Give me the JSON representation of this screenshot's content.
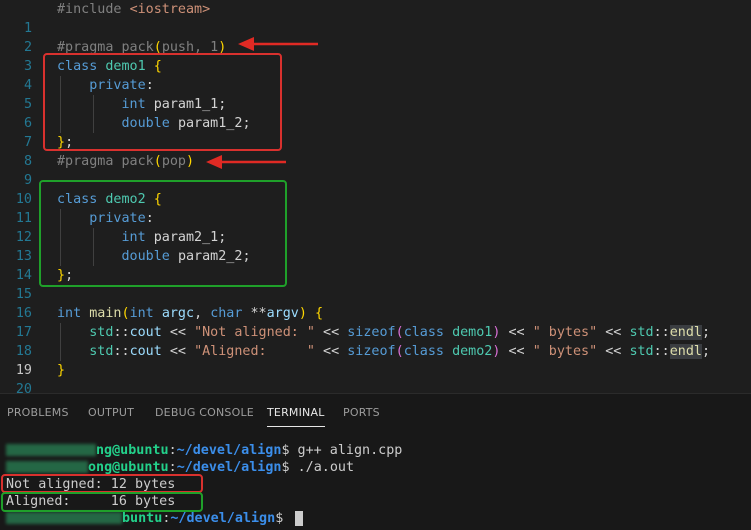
{
  "editor": {
    "line_numbers": [
      "1",
      "2",
      "3",
      "4",
      "5",
      "6",
      "7",
      "8",
      "9",
      "10",
      "11",
      "12",
      "13",
      "14",
      "15",
      "16",
      "17",
      "18",
      "19",
      "20"
    ],
    "code": {
      "l1": {
        "pre": "#include",
        "hdr": "<iostream>"
      },
      "l3": {
        "pre": "#pragma",
        "rest": " pack",
        "p1": "(",
        "args": "push, 1",
        "p2": ")"
      },
      "l4": {
        "kw": "class",
        "name": "demo1",
        "brace": "{"
      },
      "l5": {
        "access": "private",
        "colon": ":"
      },
      "l6": {
        "type": "int",
        "name": "param1_1",
        "semi": ";"
      },
      "l7": {
        "type": "double",
        "name": "param1_2",
        "semi": ";"
      },
      "l8": {
        "brace": "}",
        "semi": ";"
      },
      "l9": {
        "pre": "#pragma",
        "rest": " pack",
        "p1": "(",
        "args": "pop",
        "p2": ")"
      },
      "l11": {
        "kw": "class",
        "name": "demo2",
        "brace": "{"
      },
      "l12": {
        "access": "private",
        "colon": ":"
      },
      "l13": {
        "type": "int",
        "name": "param2_1",
        "semi": ";"
      },
      "l14": {
        "type": "double",
        "name": "param2_2",
        "semi": ";"
      },
      "l15": {
        "brace": "}",
        "semi": ";"
      },
      "l17": {
        "ret": "int",
        "fn": "main",
        "p1": "(",
        "t1": "int",
        "a1": "argc",
        "comma": ",",
        "t2": "char",
        "stars": "**",
        "a2": "argv",
        "p2": ")",
        "brace": "{"
      },
      "l18": {
        "ns": "std",
        "sep": "::",
        "cout": "cout",
        "op": " << ",
        "str": "\"Not aligned: \"",
        "op2": " << ",
        "fn": "sizeof",
        "p1": "(",
        "kw": "class",
        "cls": "demo1",
        "p2": ")",
        "op3": " << ",
        "str2": "\" bytes\"",
        "op4": " << ",
        "ns2": "std",
        "sep2": "::",
        "endl": "endl",
        "semi": ";"
      },
      "l19": {
        "ns": "std",
        "sep": "::",
        "cout": "cout",
        "op": " << ",
        "str": "\"Aligned:     \"",
        "op2": " << ",
        "fn": "sizeof",
        "p1": "(",
        "kw": "class",
        "cls": "demo2",
        "p2": ")",
        "op3": " << ",
        "str2": "\" bytes\"",
        "op4": " << ",
        "ns2": "std",
        "sep2": "::",
        "endl": "endl",
        "semi": ";"
      },
      "l20": {
        "brace": "}"
      }
    }
  },
  "panel": {
    "tabs": [
      "PROBLEMS",
      "OUTPUT",
      "DEBUG CONSOLE",
      "TERMINAL",
      "PORTS"
    ],
    "active_tab": "TERMINAL",
    "terminal": [
      {
        "user_tail": "ng@ubuntu",
        "sep": ":",
        "path": "~/devel/align",
        "prompt": "$",
        "cmd": " g++ align.cpp"
      },
      {
        "user_tail": "ong@ubuntu",
        "sep": ":",
        "path": "~/devel/align",
        "prompt": "$",
        "cmd": " ./a.out"
      },
      {
        "output": "Not aligned: 12 bytes"
      },
      {
        "output": "Aligned:     16 bytes"
      },
      {
        "user_tail": "buntu",
        "sep": ":",
        "path": "~/devel/align",
        "prompt": "$",
        "cmd": " "
      }
    ]
  },
  "colors": {
    "annotation_red": "#d9312e",
    "annotation_green": "#1fa02a",
    "terminal_user": "#23d18b",
    "terminal_path": "#3b8eea"
  }
}
